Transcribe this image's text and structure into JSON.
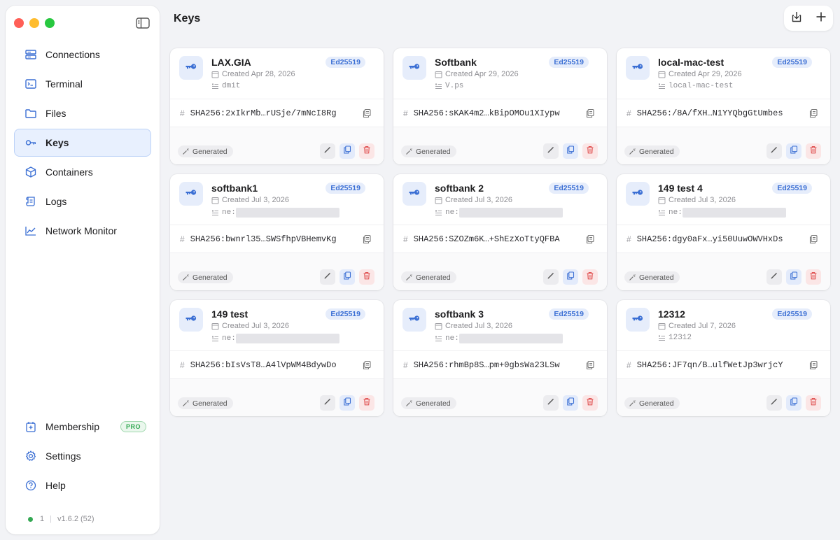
{
  "sidebar": {
    "nav": [
      {
        "label": "Connections",
        "icon": "server-stack-icon"
      },
      {
        "label": "Terminal",
        "icon": "terminal-icon"
      },
      {
        "label": "Files",
        "icon": "folder-icon"
      },
      {
        "label": "Keys",
        "icon": "key-icon",
        "active": true
      },
      {
        "label": "Containers",
        "icon": "box-icon"
      },
      {
        "label": "Logs",
        "icon": "scroll-icon"
      },
      {
        "label": "Network Monitor",
        "icon": "chart-line-icon"
      }
    ],
    "bottom": [
      {
        "label": "Membership",
        "icon": "membership-card-icon",
        "badge": "PRO"
      },
      {
        "label": "Settings",
        "icon": "gear-icon"
      },
      {
        "label": "Help",
        "icon": "question-circle-icon"
      }
    ],
    "status": {
      "count": "1",
      "version": "v1.6.2 (52)"
    }
  },
  "header": {
    "title": "Keys"
  },
  "colors": {
    "accent": "#3b6fd4",
    "status_ok": "#34a853",
    "danger": "#e05252"
  },
  "keys": [
    {
      "name": "LAX.GIA",
      "type": "Ed25519",
      "created": "Created Apr 28, 2026",
      "user": "dmit",
      "fingerprint": "SHA256:2xIkrMb…rUSje/7mNcI8Rg",
      "source": "Generated"
    },
    {
      "name": "Softbank",
      "type": "Ed25519",
      "created": "Created Apr 29, 2026",
      "user": "V.ps",
      "fingerprint": "SHA256:sKAK4m2…kBipOMOu1XIypw",
      "source": "Generated"
    },
    {
      "name": "local-mac-test",
      "type": "Ed25519",
      "created": "Created Apr 29, 2026",
      "user": "local-mac-test",
      "fingerprint": "SHA256:/8A/fXH…N1YYQbgGtUmbes",
      "source": "Generated"
    },
    {
      "name": "softbank1",
      "type": "Ed25519",
      "created": "Created Jul 3, 2026",
      "user": "ne:",
      "redacted": true,
      "fingerprint": "SHA256:bwnrl35…SWSfhpVBHemvKg",
      "source": "Generated"
    },
    {
      "name": "softbank 2",
      "type": "Ed25519",
      "created": "Created Jul 3, 2026",
      "user": "ne:",
      "redacted": true,
      "fingerprint": "SHA256:SZOZm6K…+ShEzXoTtyQFBA",
      "source": "Generated"
    },
    {
      "name": "149 test 4",
      "type": "Ed25519",
      "created": "Created Jul 3, 2026",
      "user": "ne:",
      "redacted": true,
      "fingerprint": "SHA256:dgy0aFx…yi50UuwOWVHxDs",
      "source": "Generated"
    },
    {
      "name": "149 test",
      "type": "Ed25519",
      "created": "Created Jul 3, 2026",
      "user": "ne:",
      "redacted": true,
      "fingerprint": "SHA256:bIsVsT8…A4lVpWM4BdywDo",
      "source": "Generated"
    },
    {
      "name": "softbank 3",
      "type": "Ed25519",
      "created": "Created Jul 3, 2026",
      "user": "ne:",
      "redacted": true,
      "fingerprint": "SHA256:rhmBp8S…pm+0gbsWa23LSw",
      "source": "Generated"
    },
    {
      "name": "12312",
      "type": "Ed25519",
      "created": "Created Jul 7, 2026",
      "user": "12312",
      "fingerprint": "SHA256:JF7qn/B…ulfWetJp3wrjcY",
      "source": "Generated"
    }
  ]
}
